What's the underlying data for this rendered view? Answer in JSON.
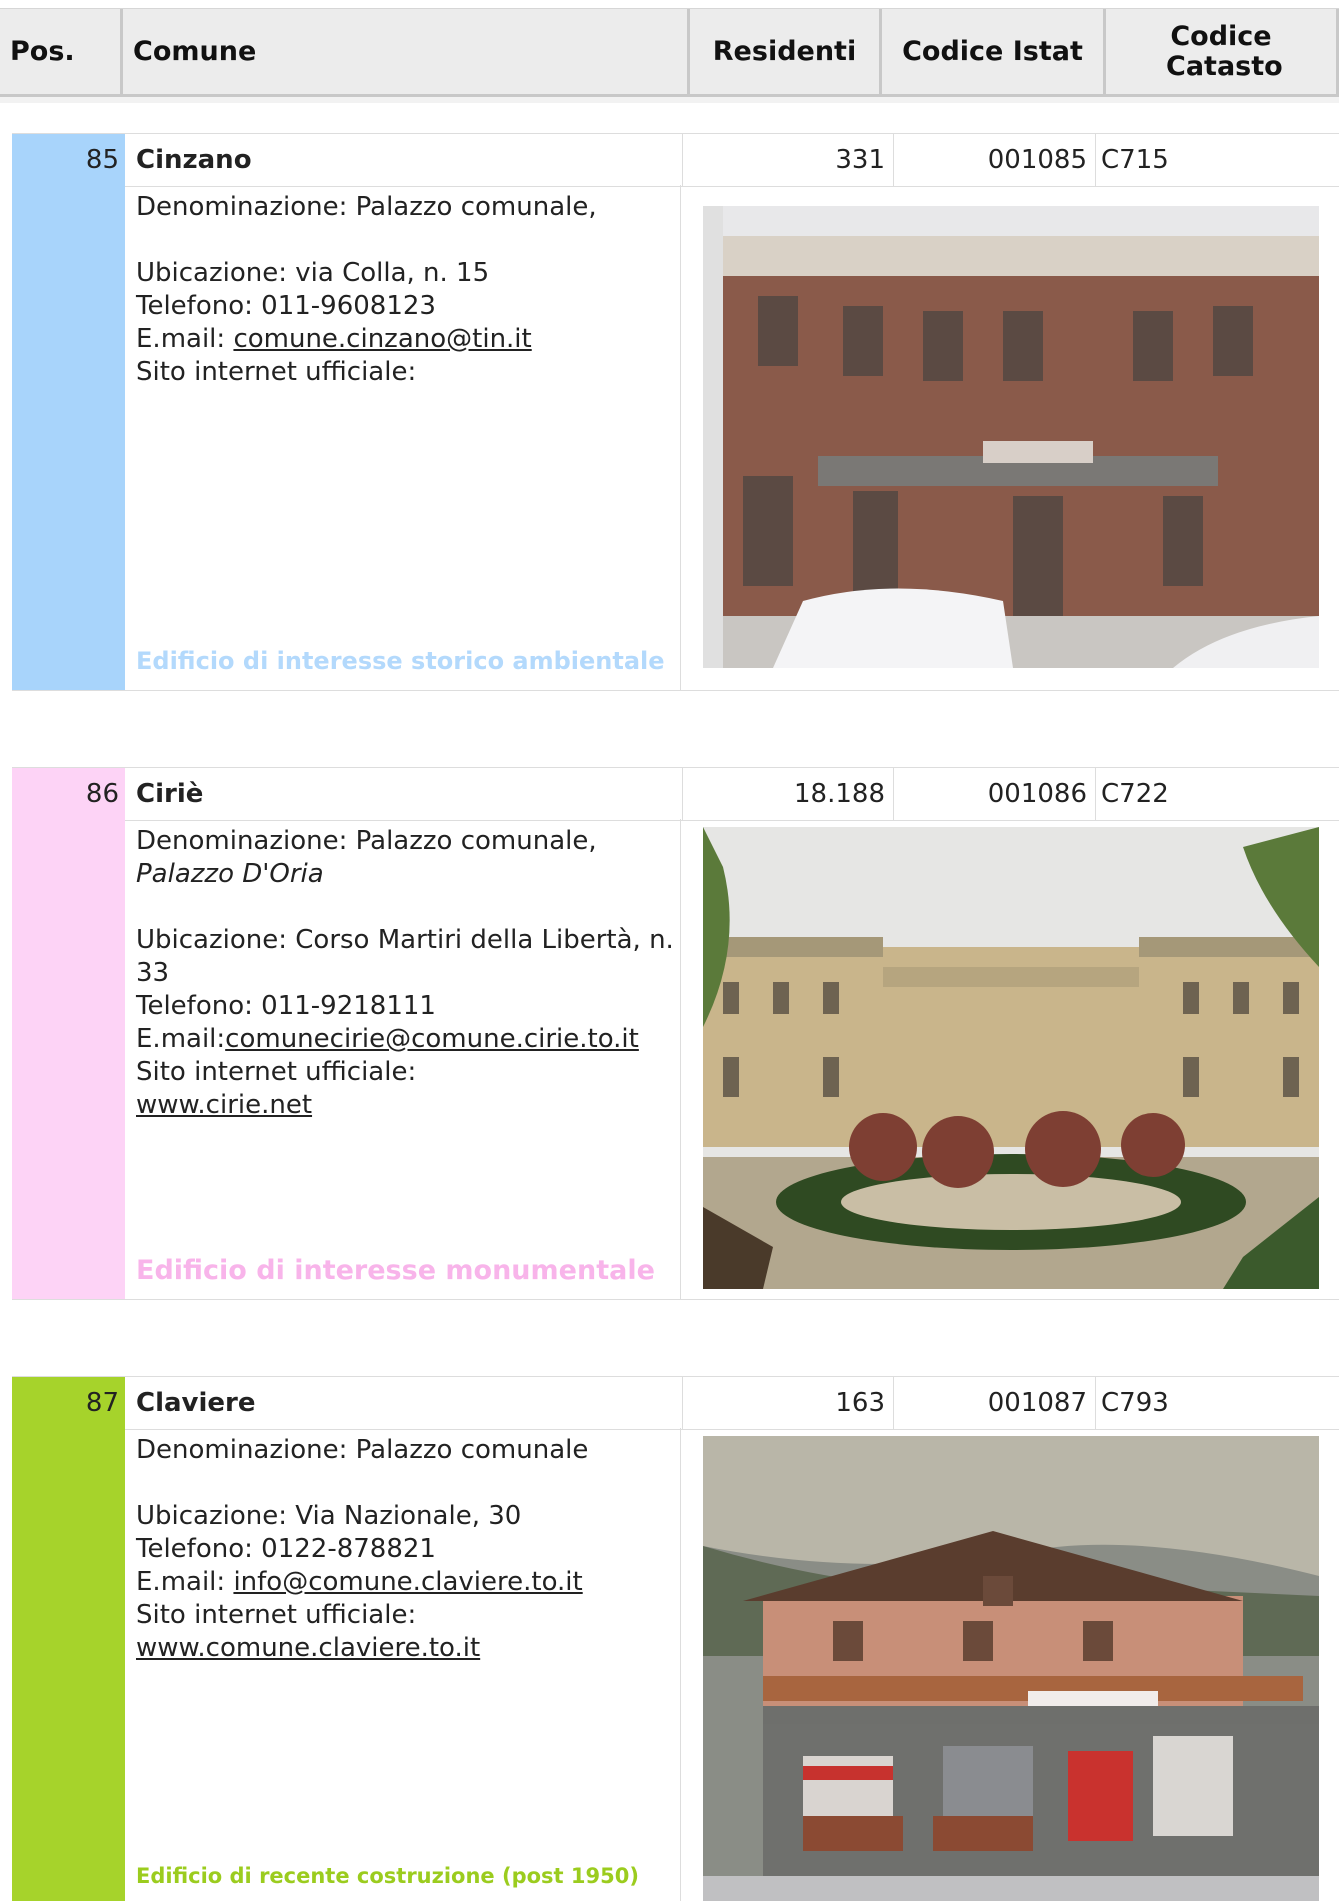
{
  "header": {
    "pos": "Pos.",
    "comune": "Comune",
    "residenti": "Residenti",
    "istat": "Codice Istat",
    "catasto": "Codice Catasto"
  },
  "entries": [
    {
      "pos": "85",
      "name": "Cinzano",
      "residenti": "331",
      "istat": "001085",
      "catasto": "C715",
      "denominazione": "Denominazione: Palazzo comunale,",
      "denominazione_extra": "",
      "ubicazione": "Ubicazione: via Colla, n. 15",
      "telefono": "Telefono: 011-9608123",
      "email_label": "E.mail: ",
      "email": "comune.cinzano@tin.it",
      "sito_label": "Sito internet ufficiale:",
      "sito": "",
      "tag": "Edificio di interesse storico ambientale",
      "color": "#a8d4fb",
      "tag_color": "#b3d9fc"
    },
    {
      "pos": "86",
      "name": "Ciriè",
      "residenti": "18.188",
      "istat": "001086",
      "catasto": "C722",
      "denominazione": "Denominazione: Palazzo comunale,",
      "denominazione_extra": "Palazzo D'Oria",
      "ubicazione": "Ubicazione: Corso Martiri della Libertà, n. 33",
      "telefono": "Telefono: 011-9218111",
      "email_label": "E.mail:",
      "email": "comunecirie@comune.cirie.to.it",
      "sito_label": "Sito internet ufficiale:",
      "sito": "www.cirie.net",
      "tag": "Edificio di interesse monumentale",
      "color": "#fdd3f6",
      "tag_color": "#f8b4ea"
    },
    {
      "pos": "87",
      "name": "Claviere",
      "residenti": "163",
      "istat": "001087",
      "catasto": "C793",
      "denominazione": "Denominazione: Palazzo comunale",
      "denominazione_extra": "",
      "ubicazione": "Ubicazione: Via Nazionale, 30",
      "telefono": "Telefono: 0122-878821",
      "email_label": "E.mail: ",
      "email": "info@comune.claviere.to.it",
      "sito_label": "Sito internet ufficiale:",
      "sito": "www.comune.claviere.to.it",
      "tag": "Edificio di recente costruzione (post 1950)",
      "color": "#a6d32b",
      "tag_color": "#9bcc1e"
    }
  ]
}
